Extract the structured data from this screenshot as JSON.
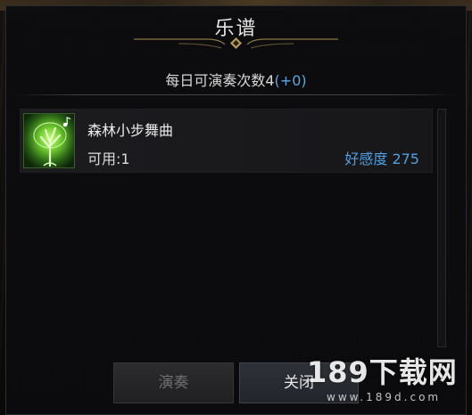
{
  "dialog": {
    "title": "乐谱",
    "daily_label": "每日可演奏次数4",
    "daily_bonus": "(+0)"
  },
  "songs": [
    {
      "name": "森林小步舞曲",
      "available": "可用:1",
      "affinity": "好感度 275",
      "icon": "tree-music-icon"
    }
  ],
  "buttons": {
    "play_label": "演奏",
    "close_label": "关闭"
  },
  "watermark": {
    "main": "189下载网",
    "sub": "www.189d.com"
  },
  "colors": {
    "accent_blue": "#4f9fe0",
    "icon_green": "#7fdc3a",
    "ornament_gold": "#b89a5a"
  }
}
